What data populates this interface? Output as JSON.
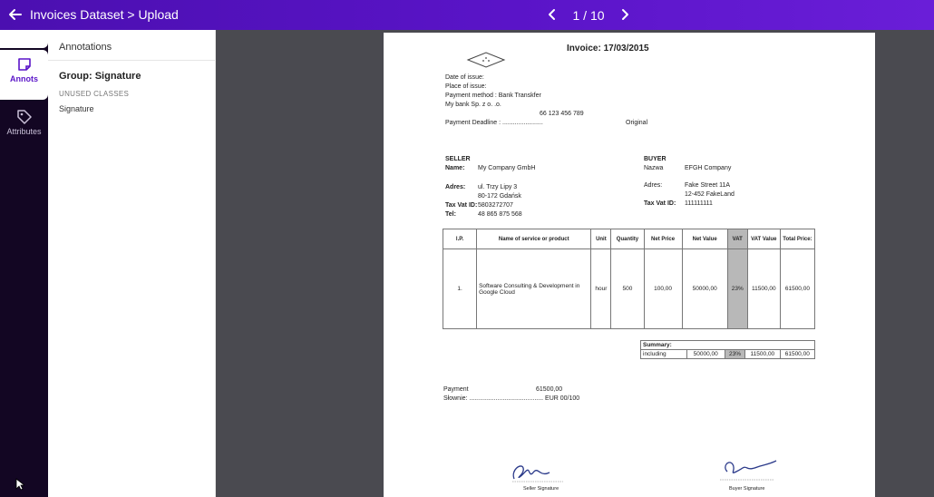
{
  "header": {
    "title": "Invoices Dataset > Upload",
    "pager": "1 / 10"
  },
  "rail": {
    "annots_label": "Annots",
    "attributes_label": "Attributes"
  },
  "panel": {
    "heading": "Annotations",
    "group": "Group: Signature",
    "unused_classes": "UNUSED CLASSES",
    "classes": [
      "Signature"
    ]
  },
  "invoice": {
    "title": "Invoice: 17/03/2015",
    "date_of_issue": "Date of issue:",
    "place_of_issue": "Place of issue:",
    "payment_method": "Payment method : Bank Transkfer",
    "bank": "My bank Sp. z o. .o.",
    "account": "66 123 456 789",
    "deadline": "Payment Deadline : .......................",
    "original": "Original",
    "seller_h": "SELLER",
    "seller_name_l": "Name:",
    "seller_name": "My Company GmbH",
    "seller_addr_l": "Adres:",
    "seller_addr1": "ul. Trzy Lipy 3",
    "seller_addr2": "80-172 Gdańsk",
    "seller_tax_l": "Tax Vat ID:",
    "seller_tax": "5803272707",
    "seller_tel_l": "Tel:",
    "seller_tel": "48 865 875 568",
    "buyer_h": "BUYER",
    "buyer_name_l": "Nazwa",
    "buyer_name": "EFGH Company",
    "buyer_addr_l": "Adres:",
    "buyer_addr1": "Fake Street 11A",
    "buyer_addr2": "12-452 FakeLand",
    "buyer_tax_l": "Tax Vat ID:",
    "buyer_tax": "111111111",
    "table_headers": [
      "l.P.",
      "Name of service or product",
      "Unit",
      "Quantity",
      "Net Price",
      "Net Value",
      "VAT",
      "VAT Value",
      "Total Price:"
    ],
    "row": [
      "1.",
      "Software Consulting & Development in Google Cloud",
      "hour",
      "500",
      "100,00",
      "50000,00",
      "23%",
      "11500,00",
      "61500,00"
    ],
    "summary_h": "Summary:",
    "summary": [
      "including",
      "50000,00",
      "23%",
      "11500,00",
      "61500,00"
    ],
    "payment_l": "Payment",
    "payment_v": "61500,00",
    "slownie": "Słownie: ..........................................  EUR 00/100",
    "seller_sig": "Seller Signature",
    "buyer_sig": "Buyer Signature"
  }
}
